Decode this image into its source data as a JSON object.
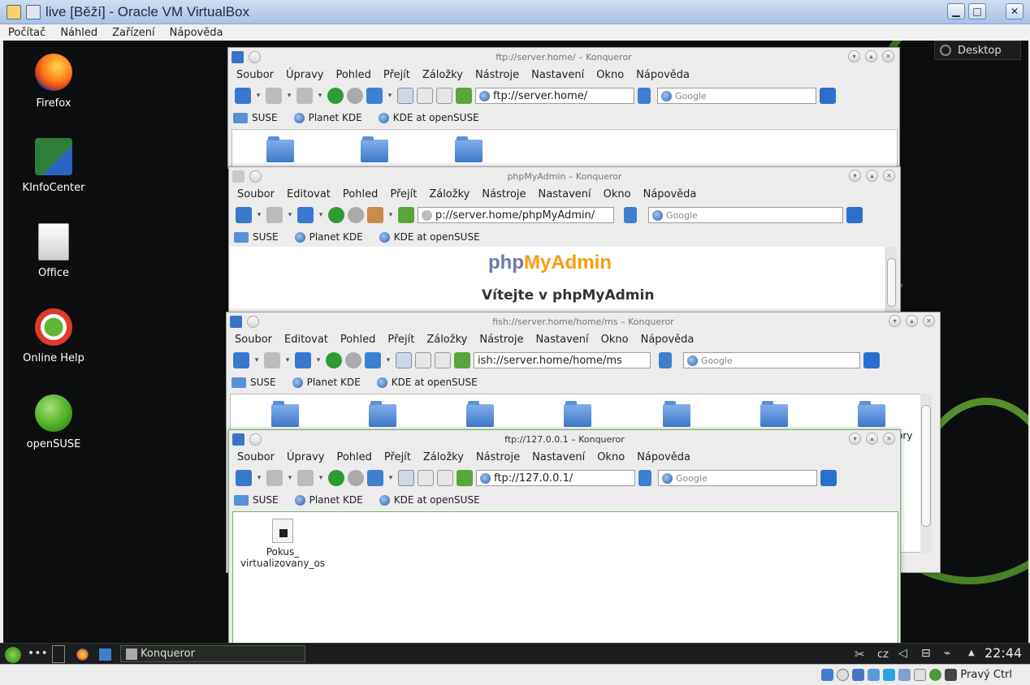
{
  "vbox": {
    "title": "live [Běží] - Oracle VM VirtualBox",
    "menu": [
      "Počítač",
      "Náhled",
      "Zařízení",
      "Nápověda"
    ],
    "status_hostkey": "Pravý Ctrl"
  },
  "desktop": {
    "button": "Desktop",
    "icons": [
      {
        "label": "Firefox",
        "icon": "firefox-icon"
      },
      {
        "label": "KInfoCenter",
        "icon": "kinfocenter-icon"
      },
      {
        "label": "Office",
        "icon": "office-icon"
      },
      {
        "label": "Online Help",
        "icon": "help-lifebuoy-icon"
      },
      {
        "label": "openSUSE",
        "icon": "opensuse-icon"
      }
    ]
  },
  "bookmarks": [
    "SUSE",
    "Planet KDE",
    "KDE at openSUSE"
  ],
  "search_placeholder": "Google",
  "windows": {
    "w1": {
      "title": "ftp://server.home/ – Konqueror",
      "menu": [
        "Soubor",
        "Úpravy",
        "Pohled",
        "Přejít",
        "Záložky",
        "Nástroje",
        "Nastavení",
        "Okno",
        "Nápověda"
      ],
      "url": "ftp://server.home/"
    },
    "w2": {
      "title": "phpMyAdmin – Konqueror",
      "menu": [
        "Soubor",
        "Editovat",
        "Pohled",
        "Přejít",
        "Záložky",
        "Nástroje",
        "Nastavení",
        "Okno",
        "Nápověda"
      ],
      "url": "p://server.home/phpMyAdmin/",
      "logo_php": "php",
      "logo_myadmin": "MyAdmin",
      "welcome": "Vítejte v phpMyAdmin"
    },
    "w3": {
      "title": "fish://server.home/home/ms – Konqueror",
      "menu": [
        "Soubor",
        "Editovat",
        "Pohled",
        "Přejít",
        "Záložky",
        "Nástroje",
        "Nastavení",
        "Okno",
        "Nápověda"
      ],
      "url": "ish://server.home/home/ms",
      "partial_label": "ory"
    },
    "w4": {
      "title": "ftp://127.0.0.1 – Konqueror",
      "menu": [
        "Soubor",
        "Úpravy",
        "Pohled",
        "Přejít",
        "Záložky",
        "Nástroje",
        "Nastavení",
        "Okno",
        "Nápověda"
      ],
      "url": "ftp://127.0.0.1/",
      "file_line1": "Pokus_",
      "file_line2": "virtualizovany_os"
    }
  },
  "taskbar": {
    "task": "Konqueror",
    "keyboard": "cz",
    "clock": "22:44"
  },
  "colors": {
    "vbox_title": "#a9c1e2",
    "desktop_bg": "#0c0e10",
    "vine_green": "#4f8d2a",
    "phpmyadmin_blue": "#6c78af",
    "phpmyadmin_orange": "#f89c0e"
  }
}
